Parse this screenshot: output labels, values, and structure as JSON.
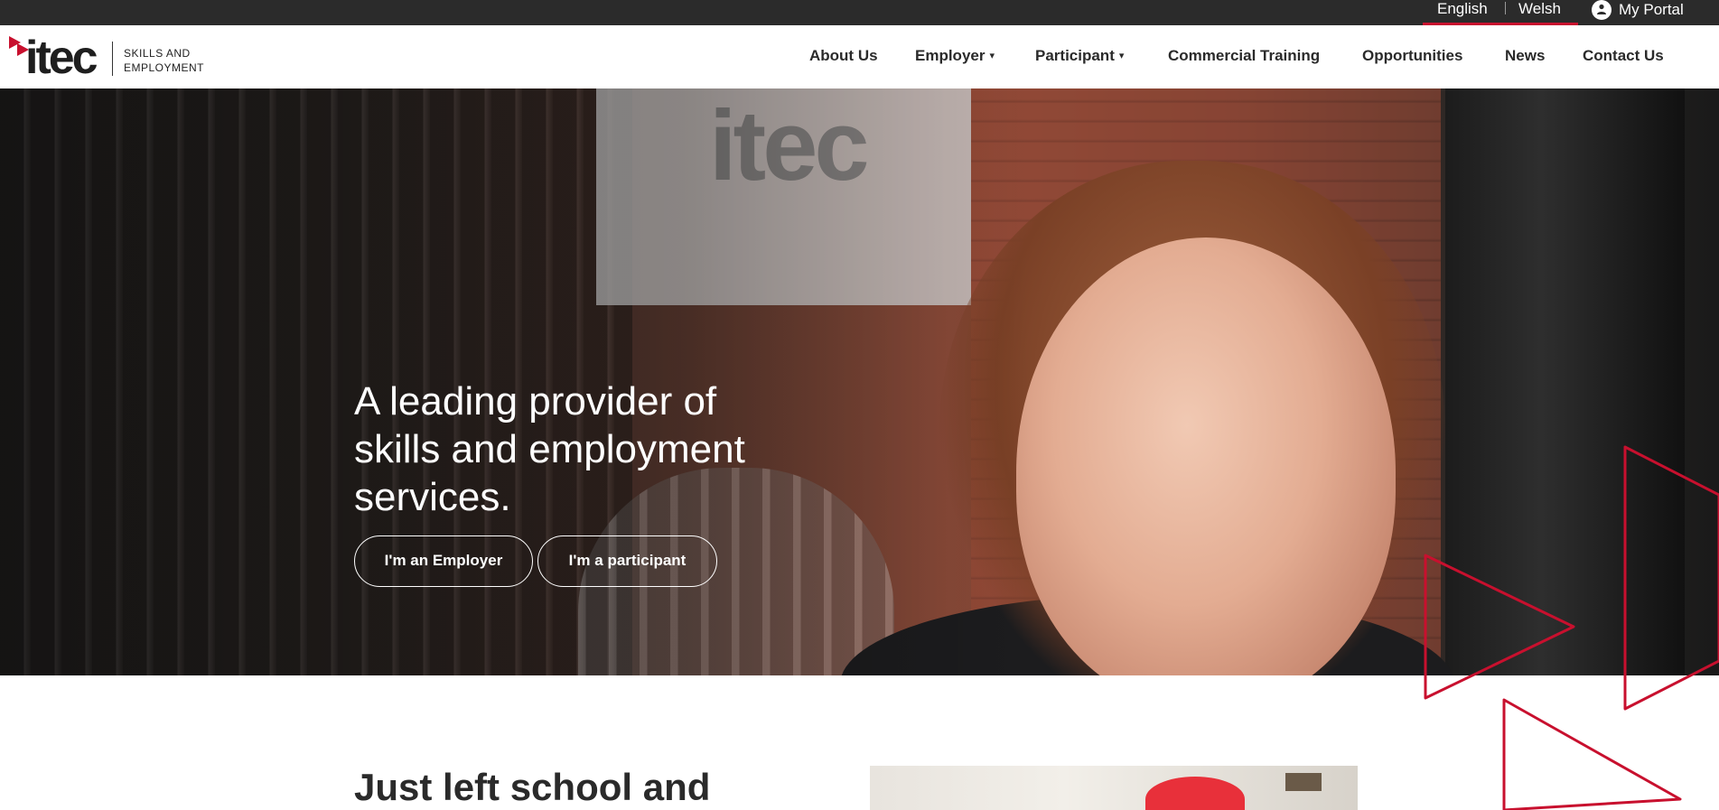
{
  "topbar": {
    "languages": [
      "English",
      "Welsh"
    ],
    "active_language": "English",
    "portal_label": "My Portal"
  },
  "brand": {
    "logo_text": "itec",
    "tagline_line1": "SKILLS AND",
    "tagline_line2": "EMPLOYMENT",
    "accent_color": "#c8102e"
  },
  "nav": {
    "items": [
      {
        "label": "About Us",
        "has_dropdown": false
      },
      {
        "label": "Employer",
        "has_dropdown": true
      },
      {
        "label": "Participant",
        "has_dropdown": true
      },
      {
        "label": "Commercial Training",
        "has_dropdown": false
      },
      {
        "label": "Opportunities",
        "has_dropdown": false
      },
      {
        "label": "News",
        "has_dropdown": false
      },
      {
        "label": "Contact Us",
        "has_dropdown": false
      }
    ],
    "caret": "▾"
  },
  "hero": {
    "heading_line1": "A leading provider of",
    "heading_line2": "skills and employment",
    "heading_line3": "services.",
    "employer_button": "I'm an Employer",
    "participant_button": "I'm a participant",
    "sign_text": "itec"
  },
  "section": {
    "heading": "Just left school and"
  },
  "icons": {
    "portal": "user-icon",
    "dropdown": "chevron-down-icon",
    "logo_mark": "play-triangles-icon",
    "decoration": "triangle-outline-icon"
  }
}
